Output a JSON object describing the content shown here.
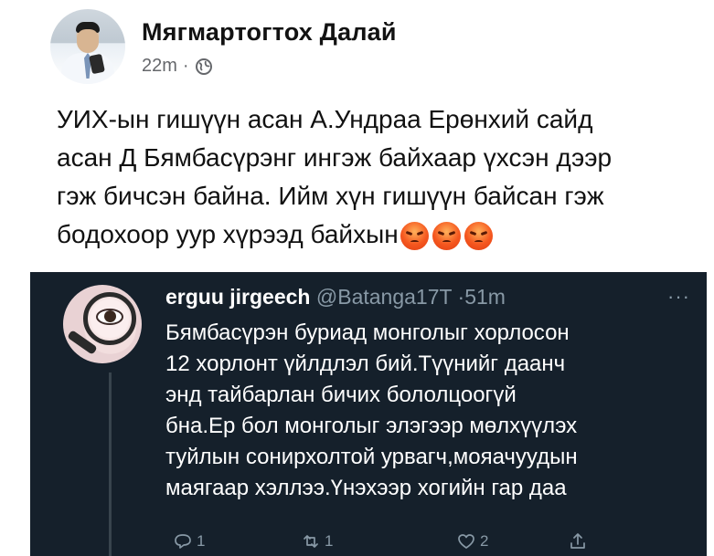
{
  "post": {
    "author_name": "Мягмартогтох Далай",
    "time": "22m",
    "separator": "·",
    "privacy_icon": "globe-icon",
    "text_lines": [
      "УИХ-ын гишүүн асан А.Ундраа Ерөнхий сайд",
      "асан Д Бямбасүрэнг ингэж байхаар үхсэн дээр",
      "гэж бичсэн байна. Ийм хүн гишүүн байсан гэж",
      "бодохоор уур хүрээд байхын"
    ],
    "emojis": [
      "angry-face",
      "angry-face",
      "angry-face"
    ]
  },
  "tweet": {
    "name": "erguu jirgeech",
    "handle": "@Batanga17T",
    "separator": "·",
    "time": "51m",
    "more_label": "···",
    "text_lines": [
      "Бямбасүрэн буриад монголыг хорлосон",
      "12 хорлонт үйлдлэл бий.Түүнийг даанч",
      "энд тайбарлан бичих бололцоогүй",
      "бна.Ер бол монголыг элэгээр мөлхүүлэх",
      "туйлын сонирхолтой урвагч,мояачуудын",
      "маягаар хэллээ.Үнэхээр хогийн гар даа"
    ],
    "actions": {
      "reply_count": "1",
      "retweet_count": "1",
      "like_count": "2"
    },
    "background_color": "#15202b"
  }
}
